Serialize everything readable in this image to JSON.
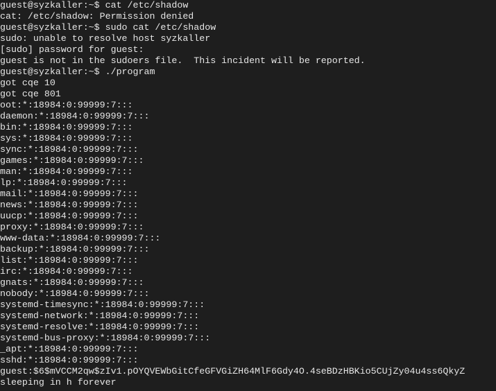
{
  "terminal": {
    "lines": [
      "guest@syzkaller:~$ cat /etc/shadow",
      "cat: /etc/shadow: Permission denied",
      "guest@syzkaller:~$ sudo cat /etc/shadow",
      "sudo: unable to resolve host syzkaller",
      "[sudo] password for guest:",
      "guest is not in the sudoers file.  This incident will be reported.",
      "guest@syzkaller:~$ ./program",
      "got cqe 10",
      "got cqe 801",
      "oot:*:18984:0:99999:7:::",
      "daemon:*:18984:0:99999:7:::",
      "bin:*:18984:0:99999:7:::",
      "sys:*:18984:0:99999:7:::",
      "sync:*:18984:0:99999:7:::",
      "games:*:18984:0:99999:7:::",
      "man:*:18984:0:99999:7:::",
      "lp:*:18984:0:99999:7:::",
      "mail:*:18984:0:99999:7:::",
      "news:*:18984:0:99999:7:::",
      "uucp:*:18984:0:99999:7:::",
      "proxy:*:18984:0:99999:7:::",
      "www-data:*:18984:0:99999:7:::",
      "backup:*:18984:0:99999:7:::",
      "list:*:18984:0:99999:7:::",
      "irc:*:18984:0:99999:7:::",
      "gnats:*:18984:0:99999:7:::",
      "nobody:*:18984:0:99999:7:::",
      "systemd-timesync:*:18984:0:99999:7:::",
      "systemd-network:*:18984:0:99999:7:::",
      "systemd-resolve:*:18984:0:99999:7:::",
      "systemd-bus-proxy:*:18984:0:99999:7:::",
      "_apt:*:18984:0:99999:7:::",
      "sshd:*:18984:0:99999:7:::",
      "guest:$6$mVCCM2qw$zIv1.pOYQVEWbGitCfeGFVGiZH64MlF6Gdy4O.4seBDzHBKio5CUjZy04u4ss6QkyZ",
      "sleeping in h forever"
    ]
  },
  "colors": {
    "background": "#1e1e1e",
    "text": "#e6e6e6"
  }
}
